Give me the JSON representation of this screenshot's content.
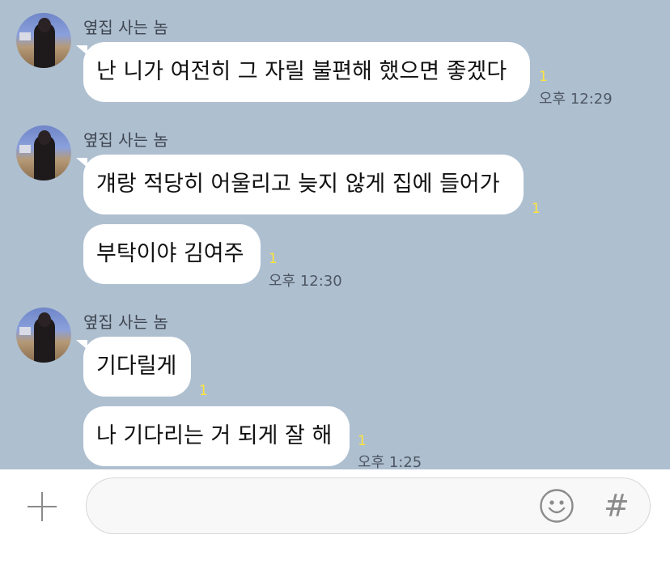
{
  "messages": [
    {
      "sender": "옆집 사는 놈",
      "bubbles": [
        "난 니가 여전히 그 자릴 불편해 했으면 좋겠다"
      ],
      "unread": [
        "1"
      ],
      "time": "오후 12:29"
    },
    {
      "sender": "옆집 사는 놈",
      "bubbles": [
        "걔랑 적당히 어울리고 늦지 않게 집에 들어가",
        "부탁이야 김여주"
      ],
      "unread": [
        "1",
        "1"
      ],
      "time": "오후 12:30"
    },
    {
      "sender": "옆집 사는 놈",
      "bubbles": [
        "기다릴게",
        "나 기다리는 거 되게 잘 해"
      ],
      "unread": [
        "1",
        "1"
      ],
      "time": "오후 1:25"
    }
  ],
  "input": {
    "placeholder": ""
  },
  "icons": {
    "add": "plus-icon",
    "emoji": "emoji-icon",
    "hashtag": "hashtag-icon"
  },
  "colors": {
    "chat_background": "#aebfd0",
    "bubble": "#ffffff",
    "unread": "#ffe43a"
  }
}
